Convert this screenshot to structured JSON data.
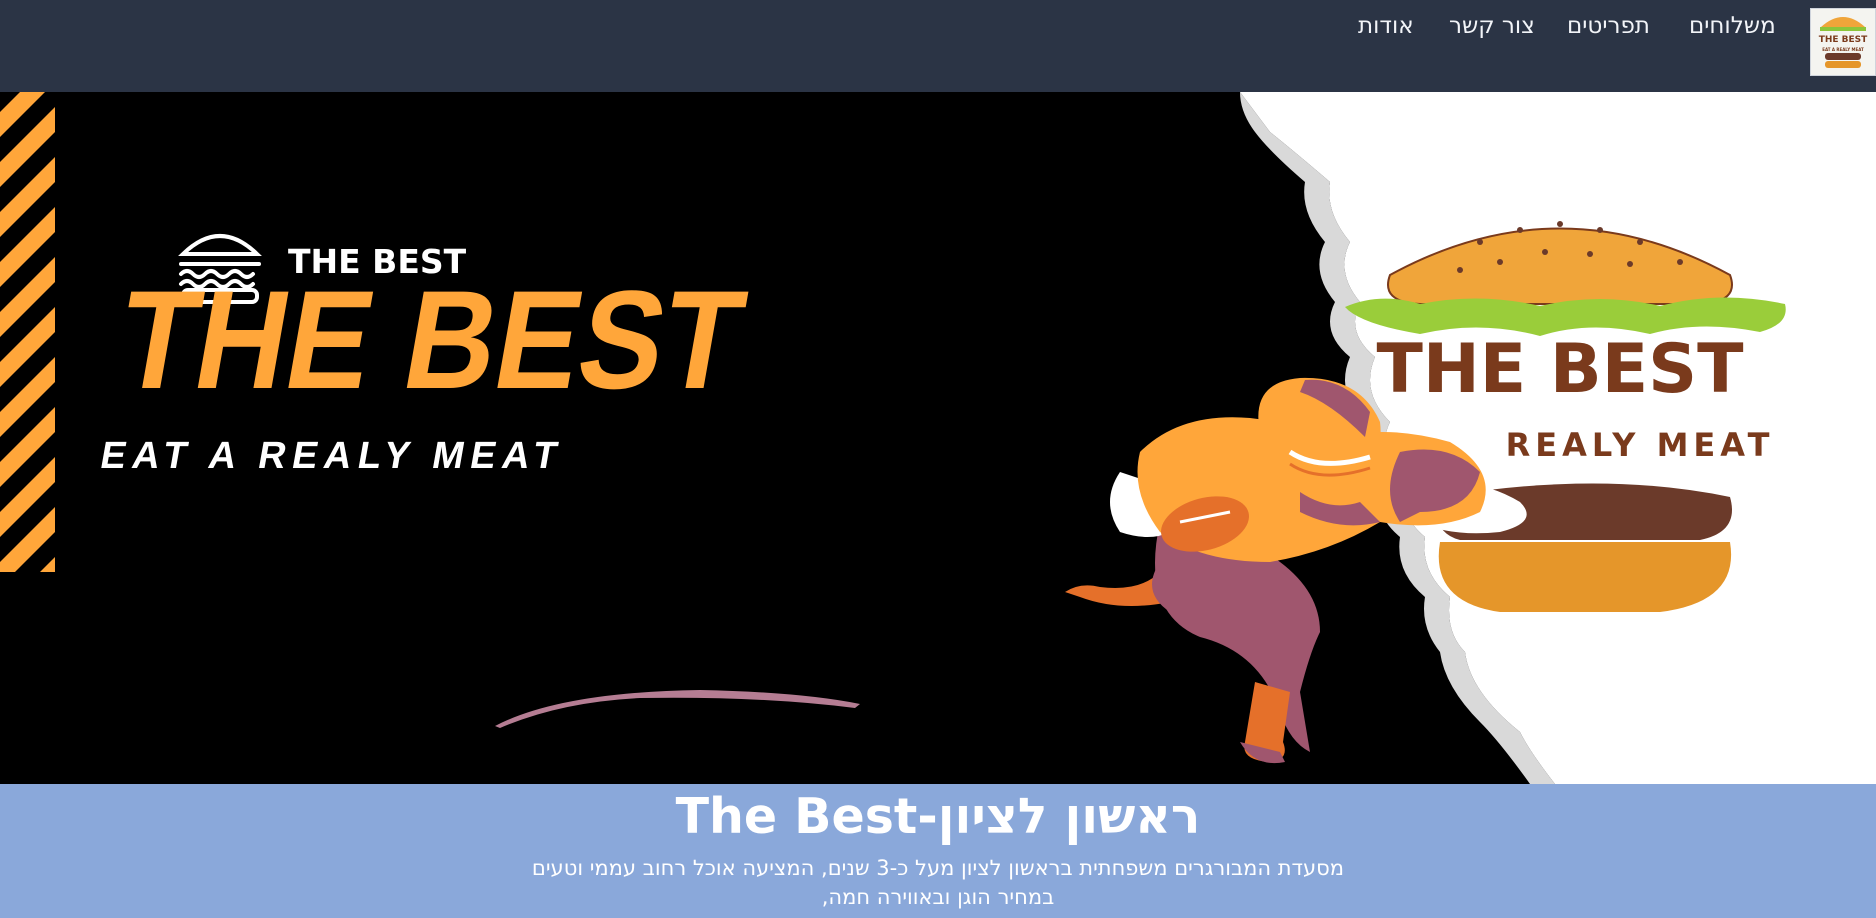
{
  "nav": {
    "links": [
      "משלוחים",
      "תפריטים",
      "צור קשר",
      "אודות"
    ]
  },
  "logo": {
    "line1": "THE BEST",
    "line2": "EAT A REALY MEAT"
  },
  "hero": {
    "small_brand": "THE BEST",
    "big_title": "THE BEST",
    "tagline": "EAT A REALY MEAT",
    "sign_title": "THE BEST",
    "sign_tagline": "REALY MEAT"
  },
  "info": {
    "title": "The Best-ראשון לציון",
    "desc_line1": "מסעדת המבורגרים משפחתית בראשון לציון מעל כ-3 שנים, המציעה אוכל רחוב עממי וטעים",
    "desc_line2": "במחיר הוגן ובאווירה חמה,"
  },
  "colors": {
    "nav_bg": "#2b3445",
    "accent_orange": "#ffa63a",
    "info_bg": "#8aa8da",
    "brown": "#7a3a1c",
    "maroon": "#a0566e"
  }
}
